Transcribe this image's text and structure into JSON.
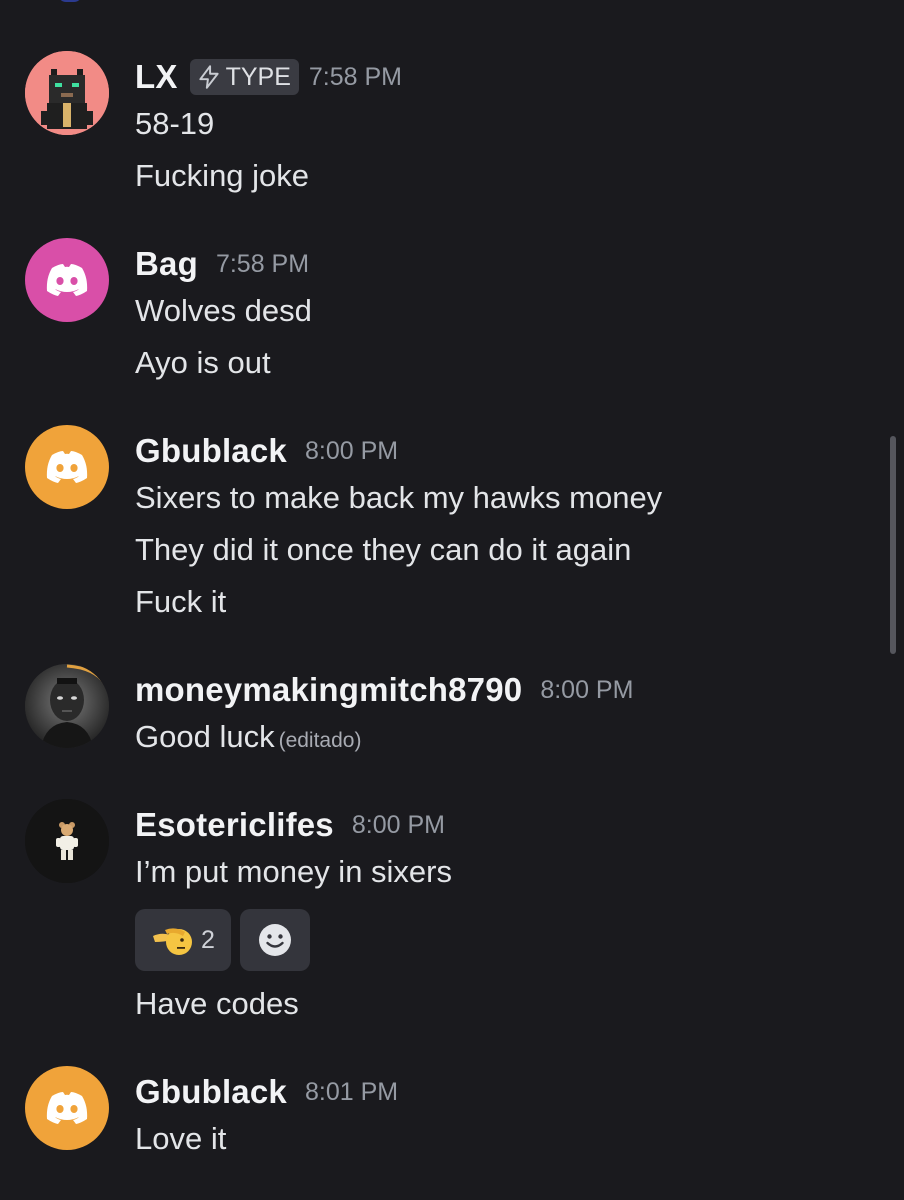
{
  "messages": [
    {
      "username": "LX",
      "tag": "TYPE",
      "time": "7:58 PM",
      "lines": [
        "58-19",
        "Fucking joke"
      ]
    },
    {
      "username": "Bag",
      "time": "7:58 PM",
      "lines": [
        "Wolves desd",
        "Ayo is out"
      ]
    },
    {
      "username": "Gbublack",
      "time": "8:00 PM",
      "lines": [
        "Sixers to make back my hawks money",
        "They did it once they can do it again",
        "Fuck it"
      ]
    },
    {
      "username": "moneymakingmitch8790",
      "time": "8:00 PM",
      "lines": [
        "Good luck"
      ],
      "edited": "(editado)"
    },
    {
      "username": "Esotericlifes",
      "time": "8:00 PM",
      "lines": [
        "I’m put money in sixers",
        "Have codes"
      ],
      "reactions": [
        {
          "emoji": "saluting-face",
          "count": "2"
        },
        {
          "emoji": "add-reaction"
        }
      ]
    },
    {
      "username": "Gbublack",
      "time": "8:01 PM",
      "lines": [
        "Love it"
      ]
    }
  ],
  "colors": {
    "background": "#1a1a1e",
    "avatar_pink": "#f08a8a",
    "avatar_magenta": "#d94fa8",
    "avatar_orange": "#f0a33a"
  }
}
